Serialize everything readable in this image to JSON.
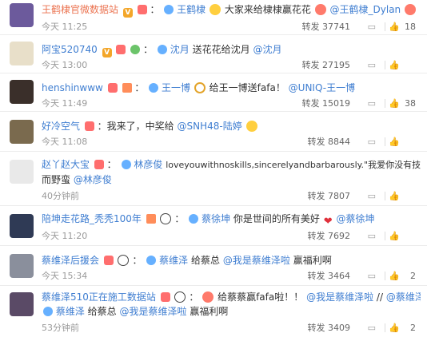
{
  "comments": [
    {
      "author": "王鹤棣官微数据站",
      "segments": [
        {
          "type": "link",
          "text": "王鹤棣"
        },
        {
          "type": "plain",
          "text": "大家来给棣棣赢花花"
        },
        {
          "type": "link",
          "text": "@王鹤棣_Dylan"
        }
      ],
      "time": "今天 11:25",
      "forward_label": "转发",
      "forwards": "37741",
      "likes": "18"
    },
    {
      "author": "阿宝520740",
      "segments": [
        {
          "type": "link",
          "text": "沈月"
        },
        {
          "type": "plain",
          "text": "送花花给沈月"
        },
        {
          "type": "link",
          "text": "@沈月"
        }
      ],
      "time": "今天 13:00",
      "forward_label": "转发",
      "forwards": "27195",
      "likes": ""
    },
    {
      "author": "henshinwww",
      "segments": [
        {
          "type": "link",
          "text": "王一博"
        },
        {
          "type": "plain",
          "text": "给王一博送fafa！"
        },
        {
          "type": "link",
          "text": "@UNIQ-王一博"
        }
      ],
      "time": "今天 11:49",
      "forward_label": "转发",
      "forwards": "15019",
      "likes": "38"
    },
    {
      "author": "好冷空气",
      "segments": [
        {
          "type": "plain",
          "text": "：我来了，中奖给"
        },
        {
          "type": "link",
          "text": "@SNH48-陆婷"
        }
      ],
      "time": "今天 11:08",
      "forward_label": "转发",
      "forwards": "8844",
      "likes": ""
    },
    {
      "author": "赵丫赵大宝",
      "segments": [
        {
          "type": "link",
          "text": "林彦俊"
        },
        {
          "type": "plain",
          "text": "loveyouwithnoskills,sincerelyandbarbarously.\"我爱你没有技巧真诚"
        }
      ],
      "segments2": [
        {
          "type": "plain",
          "text": "而野蛮"
        },
        {
          "type": "link",
          "text": "@林彦俊"
        }
      ],
      "time": "40分钟前",
      "forward_label": "转发",
      "forwards": "7807",
      "likes": ""
    },
    {
      "author": "陪坤走花路_秃秃100年",
      "segments": [
        {
          "type": "link",
          "text": "蔡徐坤"
        },
        {
          "type": "plain",
          "text": "你是世间的所有美好"
        },
        {
          "type": "link",
          "text": "@蔡徐坤"
        }
      ],
      "time": "今天 11:20",
      "forward_label": "转发",
      "forwards": "7692",
      "likes": ""
    },
    {
      "author": "蔡维泽后援会",
      "segments": [
        {
          "type": "link",
          "text": "蔡维泽"
        },
        {
          "type": "plain",
          "text": "给蔡总"
        },
        {
          "type": "link",
          "text": "@我是蔡维泽啦"
        },
        {
          "type": "plain",
          "text": "赢福利啊"
        }
      ],
      "time": "今天 15:34",
      "forward_label": "转发",
      "forwards": "3464",
      "likes": "2"
    },
    {
      "author": "蔡维泽510正在施工数据站",
      "segments": [
        {
          "type": "plain",
          "text": "给蔡蔡赢fafa啦！！"
        },
        {
          "type": "link",
          "text": "@我是蔡维泽啦"
        },
        {
          "type": "plain",
          "text": "//"
        },
        {
          "type": "link",
          "text": "@蔡维泽后援会"
        }
      ],
      "segments2": [
        {
          "type": "link",
          "text": "蔡维泽"
        },
        {
          "type": "plain",
          "text": "给蔡总"
        },
        {
          "type": "link",
          "text": "@我是蔡维泽啦"
        },
        {
          "type": "plain",
          "text": "赢福利啊"
        }
      ],
      "time": "53分钟前",
      "forward_label": "转发",
      "forwards": "3409",
      "likes": "2"
    }
  ],
  "colors": {
    "author": "#eb7350",
    "link": "#3f7ed1",
    "text": "#333333",
    "meta": "#999999"
  }
}
